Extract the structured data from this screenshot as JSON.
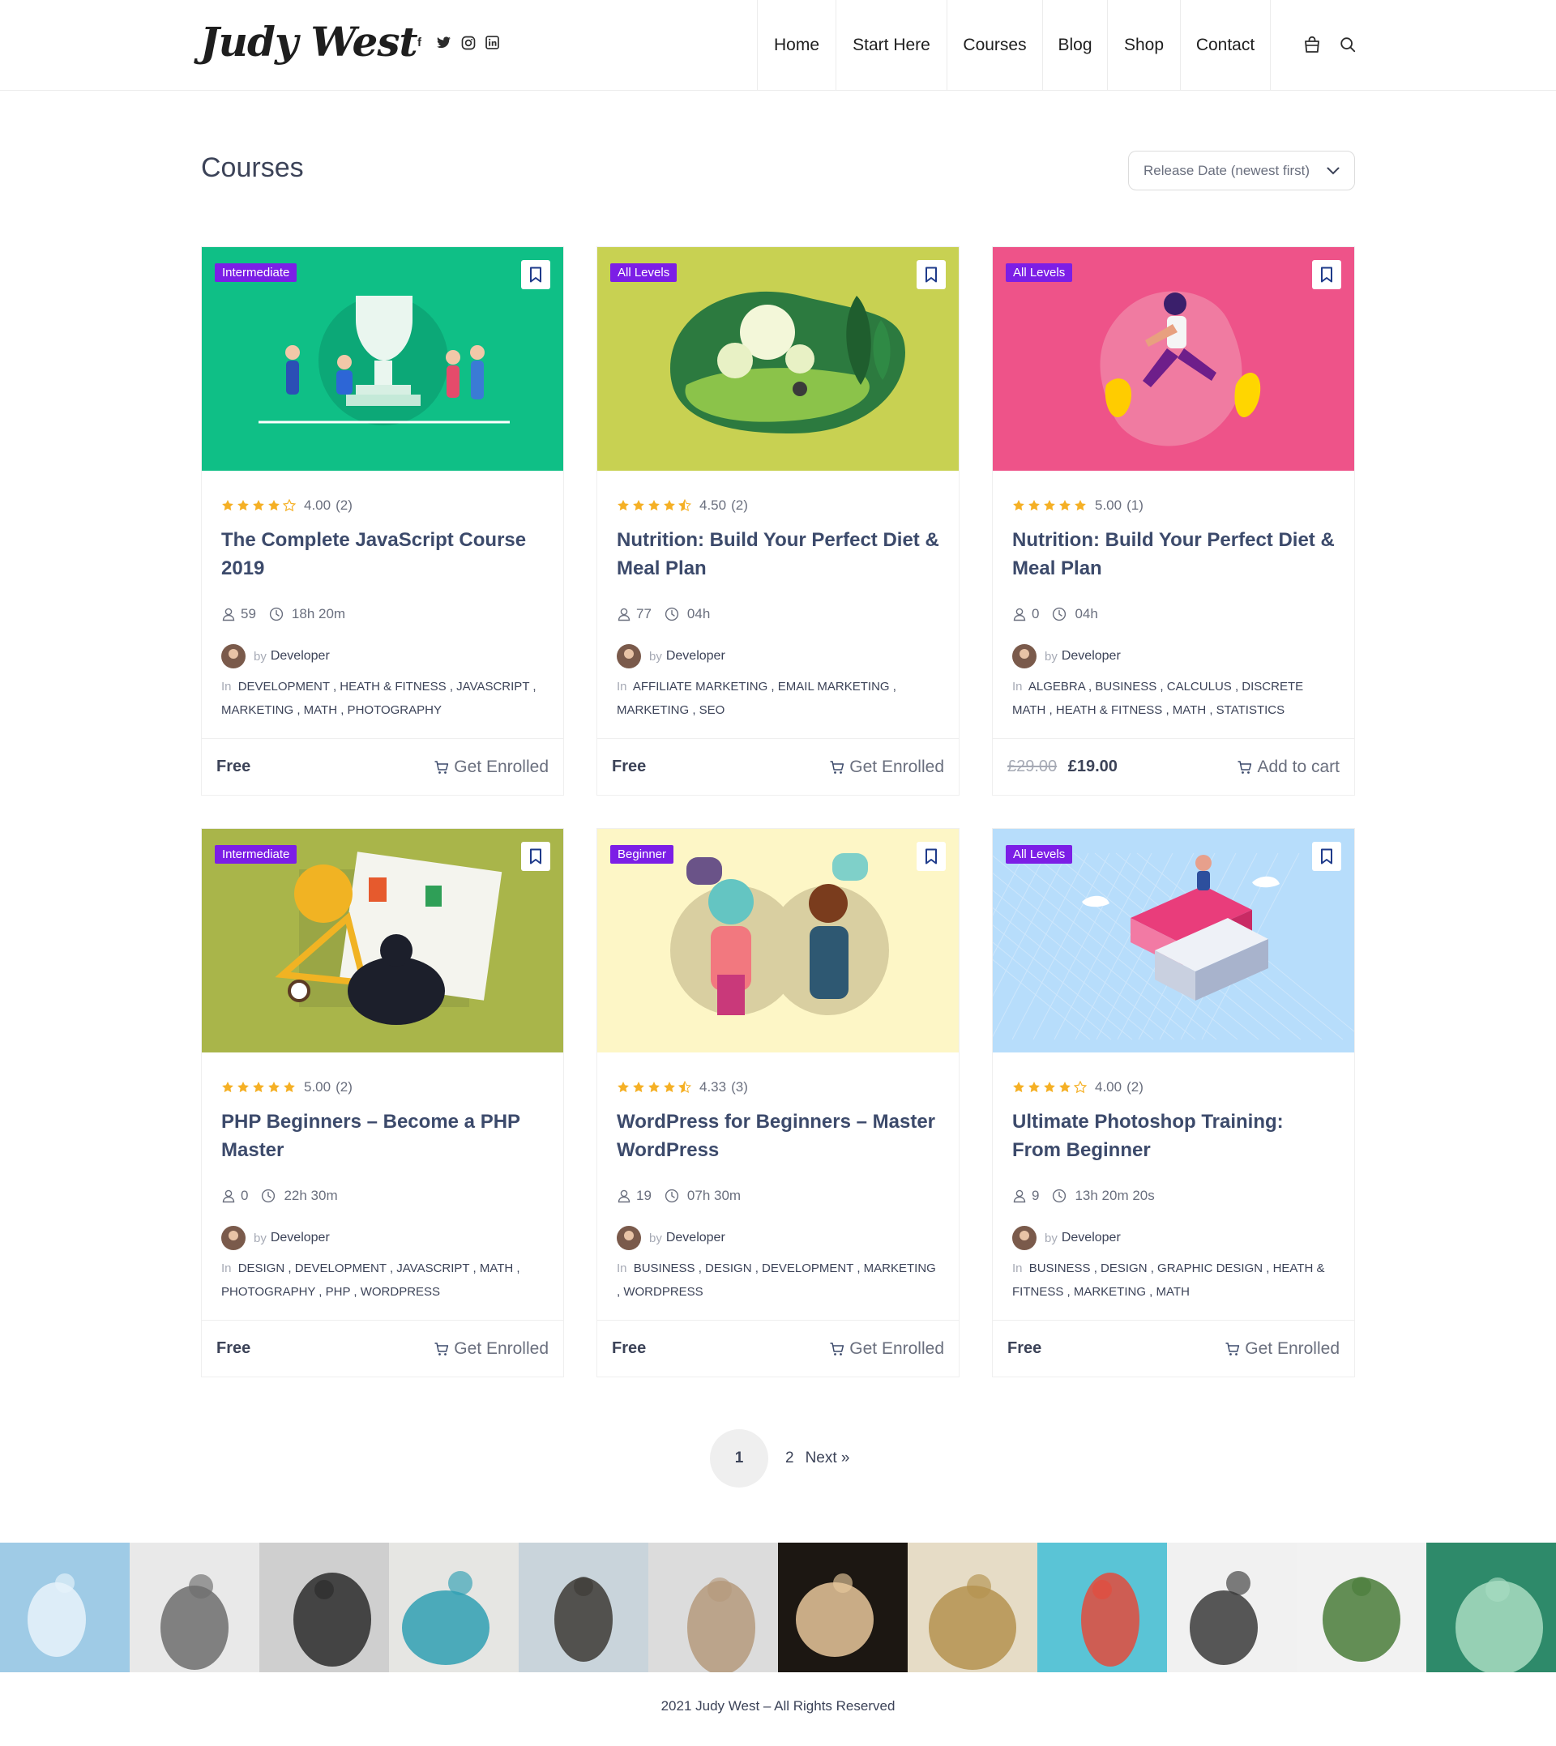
{
  "header": {
    "logo": "Judy West",
    "socials": [
      {
        "icon": "facebook-icon",
        "glyph": "f"
      },
      {
        "icon": "twitter-icon",
        "glyph": "t"
      },
      {
        "icon": "instagram-icon",
        "glyph": "◎"
      },
      {
        "icon": "linkedin-icon",
        "glyph": "in"
      }
    ],
    "nav": [
      "Home",
      "Start Here",
      "Courses",
      "Blog",
      "Shop",
      "Contact"
    ],
    "icons": [
      "cart-icon",
      "search-icon"
    ]
  },
  "page": {
    "title": "Courses",
    "sort_label": "Release Date (newest first)"
  },
  "colors": {
    "accent": "#7c1ee6",
    "star": "#f5b025",
    "heading": "#3c4a6b"
  },
  "courses": [
    {
      "level": "Intermediate",
      "thumb_color": "#0fbf86",
      "rating": 4.0,
      "rating_text": "4.00",
      "rating_count": "(2)",
      "title": "The Complete JavaScript Course 2019",
      "students": "59",
      "duration": "18h 20m",
      "by": "by",
      "author": "Developer",
      "in": "In",
      "categories": "DEVELOPMENT ,  HEATH & FITNESS ,  JAVASCRIPT ,  MARKETING ,  MATH ,  PHOTOGRAPHY",
      "price_old": "",
      "price": "Free",
      "action": "Get Enrolled"
    },
    {
      "level": "All Levels",
      "thumb_color": "#c8d152",
      "rating": 4.5,
      "rating_text": "4.50",
      "rating_count": "(2)",
      "title": "Nutrition: Build Your Perfect Diet & Meal Plan",
      "students": "77",
      "duration": "04h",
      "by": "by",
      "author": "Developer",
      "in": "In",
      "categories": "AFFILIATE MARKETING ,  EMAIL MARKETING ,  MARKETING ,  SEO",
      "price_old": "",
      "price": "Free",
      "action": "Get Enrolled"
    },
    {
      "level": "All Levels",
      "thumb_color": "#ee5389",
      "rating": 5.0,
      "rating_text": "5.00",
      "rating_count": "(1)",
      "title": "Nutrition: Build Your Perfect Diet & Meal Plan",
      "students": "0",
      "duration": "04h",
      "by": "by",
      "author": "Developer",
      "in": "In",
      "categories": "ALGEBRA ,  BUSINESS ,  CALCULUS ,  DISCRETE MATH ,  HEATH & FITNESS ,  MATH ,  STATISTICS",
      "price_old": "£29.00",
      "price": "£19.00",
      "action": "Add to cart"
    },
    {
      "level": "Intermediate",
      "thumb_color": "#a9b54a",
      "rating": 5.0,
      "rating_text": "5.00",
      "rating_count": "(2)",
      "title": "PHP Beginners – Become a PHP Master",
      "students": "0",
      "duration": "22h 30m",
      "by": "by",
      "author": "Developer",
      "in": "In",
      "categories": "DESIGN ,  DEVELOPMENT ,  JAVASCRIPT ,  MATH ,  PHOTOGRAPHY ,  PHP ,  WORDPRESS",
      "price_old": "",
      "price": "Free",
      "action": "Get Enrolled"
    },
    {
      "level": "Beginner",
      "thumb_color": "#fdf6c6",
      "rating": 4.33,
      "rating_text": "4.33",
      "rating_count": "(3)",
      "title": "WordPress for Beginners – Master WordPress",
      "students": "19",
      "duration": "07h 30m",
      "by": "by",
      "author": "Developer",
      "in": "In",
      "categories": "BUSINESS ,  DESIGN ,  DEVELOPMENT ,  MARKETING ,  WORDPRESS",
      "price_old": "",
      "price": "Free",
      "action": "Get Enrolled"
    },
    {
      "level": "All Levels",
      "thumb_color": "#b7ddfb",
      "rating": 4.0,
      "rating_text": "4.00",
      "rating_count": "(2)",
      "title": "Ultimate Photoshop Training: From Beginner",
      "students": "9",
      "duration": "13h 20m 20s",
      "by": "by",
      "author": "Developer",
      "in": "In",
      "categories": "BUSINESS ,  DESIGN ,  GRAPHIC DESIGN ,  HEATH & FITNESS ,  MARKETING ,  MATH",
      "price_old": "",
      "price": "Free",
      "action": "Get Enrolled"
    }
  ],
  "pagination": {
    "current": "1",
    "page2": "2",
    "next": "Next »"
  },
  "instagram": [
    {
      "name": "photo-ice-cave",
      "bg": "#9fcbe6",
      "fg": "#e7f3fa"
    },
    {
      "name": "photo-man-white-shirt",
      "bg": "#e9e9e9",
      "fg": "#6d6d6d"
    },
    {
      "name": "photo-man-portrait-bw",
      "bg": "#cfcfcf",
      "fg": "#2b2b2b"
    },
    {
      "name": "photo-blue-sofa",
      "bg": "#e6e6e3",
      "fg": "#2f9fb3"
    },
    {
      "name": "photo-motorcycle-desert",
      "bg": "#c9d4db",
      "fg": "#3d3a35"
    },
    {
      "name": "photo-woman-surfboard",
      "bg": "#dcdcdc",
      "fg": "#b59a7c"
    },
    {
      "name": "photo-balloon-night",
      "bg": "#1c1712",
      "fg": "#e7c79b"
    },
    {
      "name": "photo-field-tree",
      "bg": "#e6dcc6",
      "fg": "#b4924f"
    },
    {
      "name": "photo-sea-float",
      "bg": "#5ac4d6",
      "fg": "#e34b3c"
    },
    {
      "name": "photo-woman-motorbike",
      "bg": "#f1f1f1",
      "fg": "#3b3b3b"
    },
    {
      "name": "photo-woman-plant",
      "bg": "#f2f2f2",
      "fg": "#4a7d3a"
    },
    {
      "name": "photo-green-leaves",
      "bg": "#2e8a6a",
      "fg": "#a8dcc1"
    }
  ],
  "footer": {
    "text": "2021 Judy West – All Rights Reserved"
  }
}
